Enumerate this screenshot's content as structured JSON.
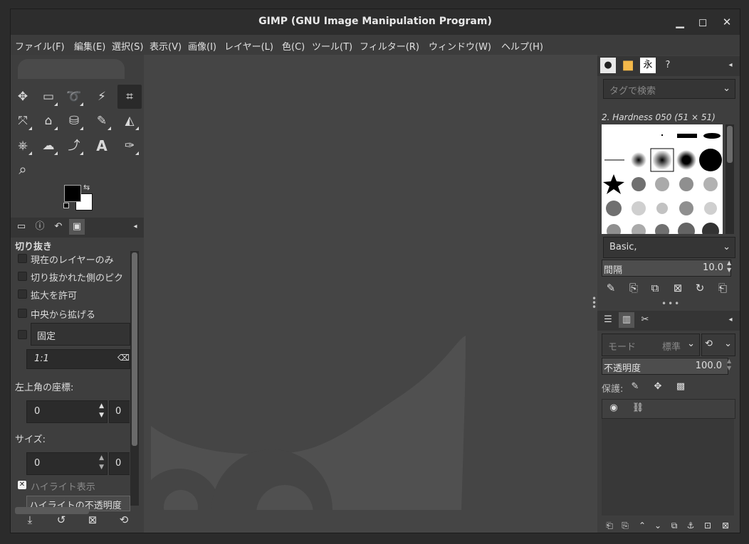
{
  "window": {
    "title": "GIMP (GNU Image Manipulation Program)",
    "minimize": "▁",
    "maximize": "◻",
    "close": "✕"
  },
  "menu": [
    "ファイル(F)",
    "編集(E)",
    "選択(S)",
    "表示(V)",
    "画像(I)",
    "レイヤー(L)",
    "色(C)",
    "ツール(T)",
    "フィルター(R)",
    "ウィンドウ(W)",
    "ヘルプ(H)"
  ],
  "tools": {
    "move": "✥",
    "rect_select": "▭",
    "lasso": "➰",
    "fuzzy": "⚡",
    "crop": "⌗",
    "transform": "⤧",
    "warp": "⌂",
    "bucket": "⛁",
    "paintbrush": "✎",
    "eraser": "◭",
    "clone": "⎈",
    "smudge": "☁",
    "path": "⤴",
    "text": "A",
    "colorpicker": "✑",
    "zoom": "⌕"
  },
  "colors": {
    "foreground": "#000000",
    "background": "#ffffff",
    "accent": "#f5b94a"
  },
  "tool_options": {
    "title": "切り抜き",
    "current_layer_only": "現在のレイヤーのみ",
    "delete_cropped": "切り抜かれた側のピク",
    "allow_growing": "拡大を許可",
    "expand_from_center": "中央から拡げる",
    "fixed_label": "固定",
    "ratio_value": "1:1",
    "position_label": "左上角の座標:",
    "position_x": "0",
    "position_y": "0",
    "size_label": "サイズ:",
    "size_w": "0",
    "size_h": "0",
    "highlight_label": "ハイライト表示",
    "highlight_opacity": "ハイライトの不透明度"
  },
  "brushes": {
    "search_placeholder": "タグで検索",
    "brush_name": "2. Hardness 050 (51 × 51)",
    "preset": "Basic,",
    "spacing_label": "間隔",
    "spacing_value": "10.0"
  },
  "layers": {
    "mode_label": "モード",
    "mode_value": "標準",
    "opacity_label": "不透明度",
    "opacity_value": "100.0",
    "lock_label": "保護:"
  }
}
